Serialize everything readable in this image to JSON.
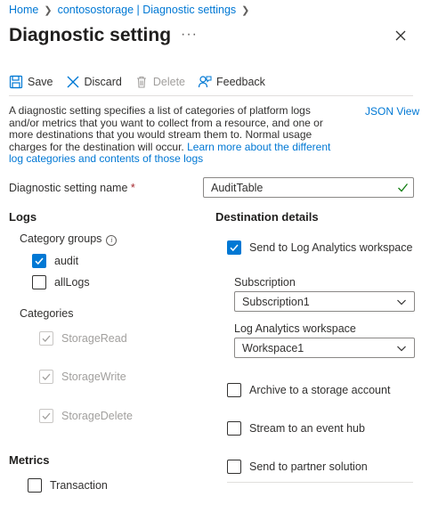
{
  "breadcrumb": {
    "items": [
      "Home",
      "contosostorage | Diagnostic settings"
    ]
  },
  "header": {
    "title": "Diagnostic setting",
    "more_label": "···"
  },
  "toolbar": {
    "save_label": "Save",
    "discard_label": "Discard",
    "delete_label": "Delete",
    "feedback_label": "Feedback"
  },
  "description": {
    "text": "A diagnostic setting specifies a list of categories of platform logs and/or metrics that you want to collect from a resource, and one or more destinations that you would stream them to. Normal usage charges for the destination will occur. ",
    "link_text": "Learn more about the different log categories and contents of those logs",
    "json_view_label": "JSON View"
  },
  "name_field": {
    "label": "Diagnostic setting name",
    "required_mark": "*",
    "value": "AuditTable"
  },
  "logs": {
    "heading": "Logs",
    "category_groups_label": "Category groups",
    "info_glyph": "i",
    "category_groups": [
      {
        "label": "audit",
        "checked": true
      },
      {
        "label": "allLogs",
        "checked": false
      }
    ],
    "categories_label": "Categories",
    "categories": [
      {
        "label": "StorageRead",
        "checked": true,
        "disabled": true
      },
      {
        "label": "StorageWrite",
        "checked": true,
        "disabled": true
      },
      {
        "label": "StorageDelete",
        "checked": true,
        "disabled": true
      }
    ]
  },
  "metrics": {
    "heading": "Metrics",
    "items": [
      {
        "label": "Transaction",
        "checked": false
      }
    ]
  },
  "destination": {
    "heading": "Destination details",
    "log_analytics": {
      "label": "Send to Log Analytics workspace",
      "checked": true
    },
    "subscription": {
      "label": "Subscription",
      "value": "Subscription1"
    },
    "workspace": {
      "label": "Log Analytics workspace",
      "value": "Workspace1"
    },
    "archive": {
      "label": "Archive to a storage account",
      "checked": false
    },
    "event_hub": {
      "label": "Stream to an event hub",
      "checked": false
    },
    "partner": {
      "label": "Send to partner solution",
      "checked": false
    }
  },
  "colors": {
    "accent": "#0078d4",
    "valid": "#107c10",
    "disabled": "#a19f9d"
  }
}
